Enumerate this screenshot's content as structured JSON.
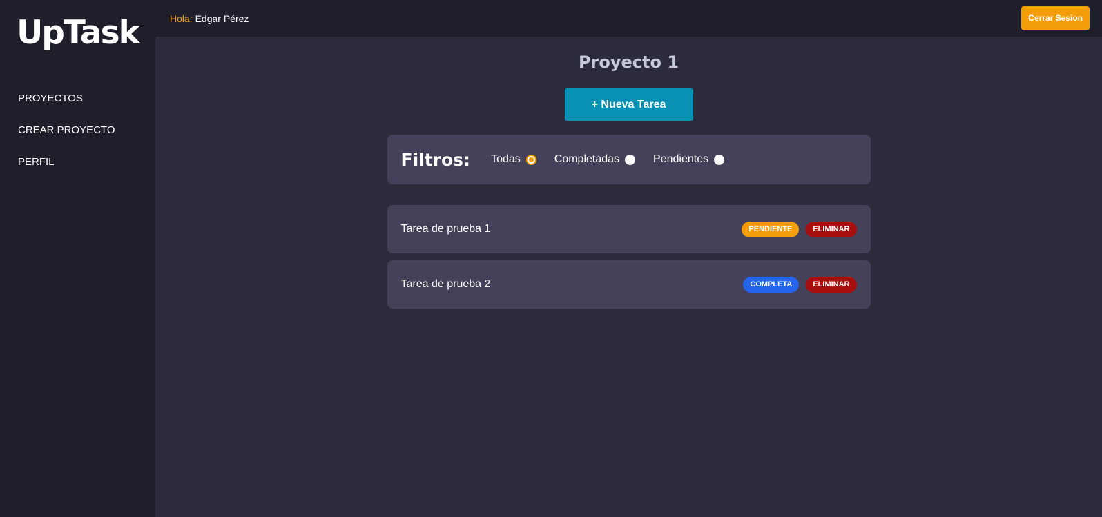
{
  "app": {
    "logo": "UpTask"
  },
  "sidebar": {
    "items": [
      {
        "label": "PROYECTOS"
      },
      {
        "label": "CREAR PROYECTO"
      },
      {
        "label": "PERFIL"
      }
    ]
  },
  "header": {
    "greeting_prefix": "Hola:",
    "user_name": "Edgar Pérez",
    "logout_label": "Cerrar Sesion"
  },
  "project": {
    "title": "Proyecto 1",
    "new_task_label": "+ Nueva Tarea"
  },
  "filters": {
    "title": "Filtros:",
    "options": [
      {
        "label": "Todas",
        "selected": true
      },
      {
        "label": "Completadas",
        "selected": false
      },
      {
        "label": "Pendientes",
        "selected": false
      }
    ]
  },
  "tasks": [
    {
      "name": "Tarea de prueba 1",
      "status_label": "PENDIENTE",
      "status_color": "#f59e0b",
      "delete_label": "ELIMINAR"
    },
    {
      "name": "Tarea de prueba 2",
      "status_label": "COMPLETA",
      "status_color": "#2563eb",
      "delete_label": "ELIMINAR"
    }
  ],
  "colors": {
    "accent": "#f59e0b",
    "primary_button": "#0891b2",
    "danger": "#a70f0f",
    "sidebar_bg": "#1f1f2b",
    "content_bg": "#2d2c3c",
    "card_bg": "#43425a"
  }
}
